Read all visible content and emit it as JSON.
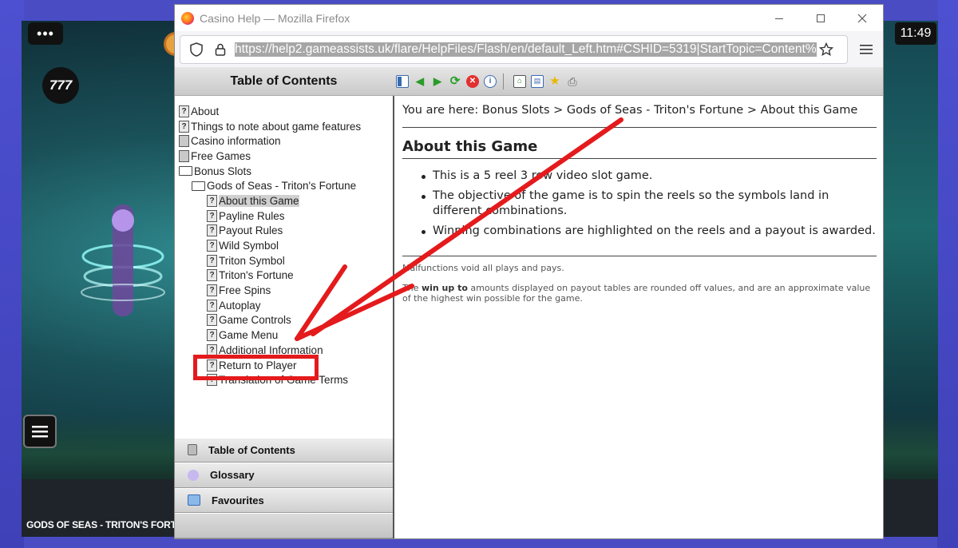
{
  "game": {
    "menu_dots": "•••",
    "logo_text": "777",
    "clock": "11:49",
    "title": "GODS OF SEAS - TRITON'S FORTUNE"
  },
  "browser": {
    "window_title": "Casino Help — Mozilla Firefox",
    "url": "https://help2.gameassists.uk/flare/HelpFiles/Flash/en/default_Left.htm#CSHID=5319|StartTopic=Content%"
  },
  "help": {
    "toolbar_title": "Table of Contents",
    "toc": [
      {
        "label": "About",
        "level": 0,
        "icon": "help-page-icon"
      },
      {
        "label": "Things to note about game features",
        "level": 0,
        "icon": "help-page-icon"
      },
      {
        "label": "Casino information",
        "level": 0,
        "icon": "closed-book-icon"
      },
      {
        "label": "Free Games",
        "level": 0,
        "icon": "closed-book-icon"
      },
      {
        "label": "Bonus Slots",
        "level": 0,
        "icon": "open-book-icon"
      },
      {
        "label": "Gods of Seas - Triton's Fortune",
        "level": 1,
        "icon": "open-book-icon"
      },
      {
        "label": "About this Game",
        "level": 2,
        "icon": "help-page-icon",
        "active": true
      },
      {
        "label": "Payline Rules",
        "level": 2,
        "icon": "help-page-icon"
      },
      {
        "label": "Payout Rules",
        "level": 2,
        "icon": "help-page-icon"
      },
      {
        "label": "Wild Symbol",
        "level": 2,
        "icon": "help-page-icon"
      },
      {
        "label": "Triton Symbol",
        "level": 2,
        "icon": "help-page-icon"
      },
      {
        "label": "Triton's Fortune",
        "level": 2,
        "icon": "help-page-icon"
      },
      {
        "label": "Free Spins",
        "level": 2,
        "icon": "help-page-icon"
      },
      {
        "label": "Autoplay",
        "level": 2,
        "icon": "help-page-icon"
      },
      {
        "label": "Game Controls",
        "level": 2,
        "icon": "help-page-icon"
      },
      {
        "label": "Game Menu",
        "level": 2,
        "icon": "help-page-icon"
      },
      {
        "label": "Additional Information",
        "level": 2,
        "icon": "help-page-icon"
      },
      {
        "label": "Return to Player",
        "level": 2,
        "icon": "help-page-icon"
      },
      {
        "label": "Translation of Game Terms",
        "level": 2,
        "icon": "help-page-icon"
      }
    ],
    "nav_tabs": [
      {
        "label": "Table of Contents",
        "icon": "toc-icon"
      },
      {
        "label": "Glossary",
        "icon": "glossary-icon"
      },
      {
        "label": "Favourites",
        "icon": "favourites-icon"
      }
    ],
    "breadcrumb": "You are here: Bonus Slots > Gods of Seas - Triton's Fortune   > About this Game",
    "heading": "About this Game",
    "bullets": [
      "This is a 5 reel 3 row video slot game.",
      "The objective of the game is to spin the reels so the symbols land in different combinations.",
      "Winning combinations are highlighted on the reels and a payout is awarded."
    ],
    "fine_print_1": "Malfunctions void all plays and pays.",
    "fine_print_2_pre": "The ",
    "fine_print_2_bold": "win up to",
    "fine_print_2_post": " amounts displayed on payout tables are rounded off values, and are an approximate value of the highest win possible for the game.",
    "annotation_color": "#e41a1c"
  }
}
